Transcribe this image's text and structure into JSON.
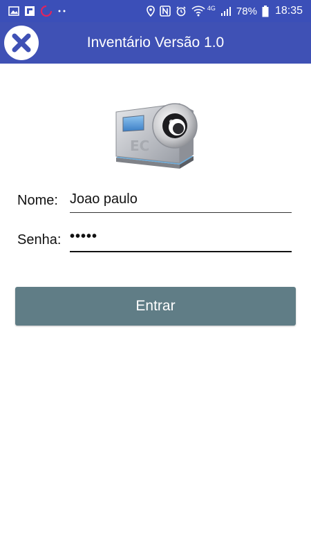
{
  "status_bar": {
    "left_icons": [
      "gallery-icon",
      "flipboard-icon",
      "loading-circle-icon",
      "more-dots-icon"
    ],
    "right_icons": [
      "location-icon",
      "nfc-icon",
      "alarm-icon",
      "wifi-icon",
      "signal-icon",
      "battery-icon"
    ],
    "network_label": "4G",
    "battery_percent": "78%",
    "time": "18:35"
  },
  "toolbar": {
    "close_icon": "close-icon",
    "title": "Inventário Versão 1.0"
  },
  "logo": {
    "icon": "camera-logo-icon"
  },
  "form": {
    "name_label": "Nome:",
    "name_value": "Joao paulo",
    "password_label": "Senha:",
    "password_value": "•••••"
  },
  "actions": {
    "enter_label": "Entrar"
  },
  "colors": {
    "status_bar": "#3b4fb8",
    "toolbar": "#3f51b5",
    "button": "#607d86"
  }
}
